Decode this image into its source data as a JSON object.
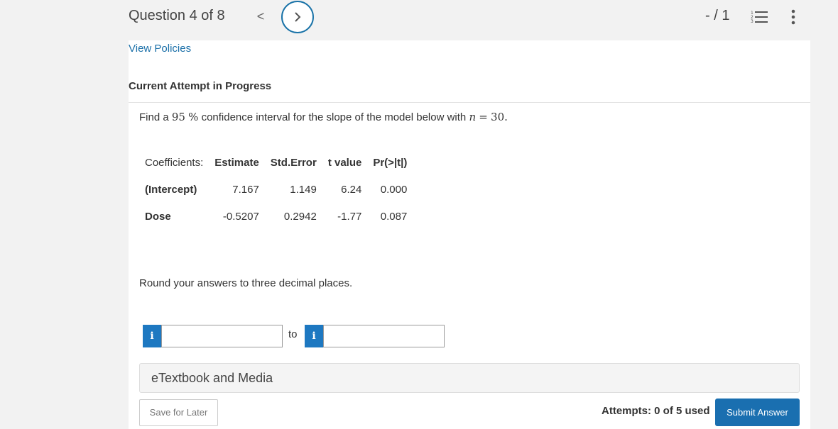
{
  "header": {
    "question_label": "Question 4 of 8",
    "prev_glyph": "<",
    "score": "- / 1"
  },
  "view_policies": "View Policies",
  "attempt_title": "Current Attempt in Progress",
  "question": {
    "prefix": "Find a ",
    "confidence": "95",
    "percent": "%",
    "middle": "confidence interval for the slope of the model below with ",
    "n_var": "n",
    "equals": "=",
    "n_value": "30",
    "suffix": "."
  },
  "table": {
    "headers": [
      "Coefficients:",
      "Estimate",
      "Std.Error",
      "t value",
      "Pr(>|t|)"
    ],
    "rows": [
      [
        "(Intercept)",
        "7.167",
        "1.149",
        "6.24",
        "0.000"
      ],
      [
        "Dose",
        "-0.5207",
        "0.2942",
        "-1.77",
        "0.087"
      ]
    ]
  },
  "round_note": "Round your answers to three decimal places.",
  "answer": {
    "info_glyph": "i",
    "to_label": "to",
    "lower_value": "",
    "upper_value": ""
  },
  "etextbook_label": "eTextbook and Media",
  "footer": {
    "save_later": "Save for Later",
    "attempts": "Attempts: 0 of 5 used",
    "submit": "Submit Answer"
  },
  "colors": {
    "accent": "#1a6fb0",
    "info": "#1d78c1",
    "link": "#1a6fa8"
  }
}
